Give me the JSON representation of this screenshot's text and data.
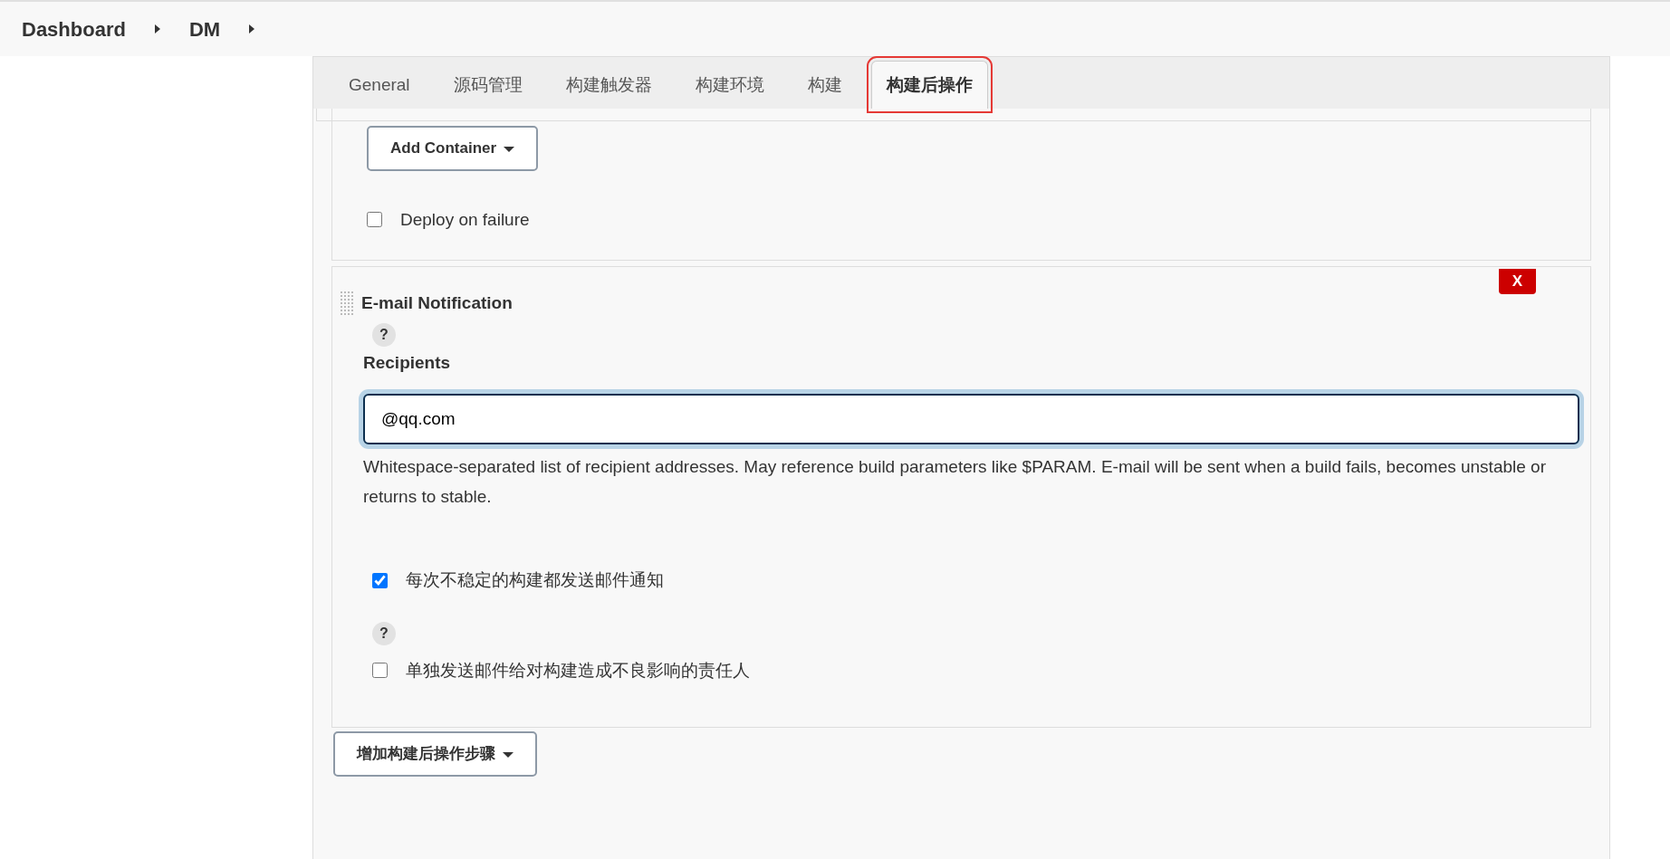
{
  "breadcrumb": [
    {
      "label": "Dashboard"
    },
    {
      "label": "DM"
    }
  ],
  "tabs": [
    {
      "label": "General",
      "selected": false
    },
    {
      "label": "源码管理",
      "selected": false
    },
    {
      "label": "构建触发器",
      "selected": false
    },
    {
      "label": "构建环境",
      "selected": false
    },
    {
      "label": "构建",
      "selected": false
    },
    {
      "label": "构建后操作",
      "selected": true
    }
  ],
  "previous_section": {
    "add_button": "Add Container",
    "deploy_on_failure": {
      "label": "Deploy on failure",
      "checked": false
    }
  },
  "email_section": {
    "title": "E-mail Notification",
    "delete_button": "X",
    "help": "?",
    "recipients_label": "Recipients",
    "recipients_value": "@qq.com",
    "description": "Whitespace-separated list of recipient addresses. May reference build parameters like $PARAM. E-mail will be sent when a build fails, becomes unstable or returns to stable.",
    "options": [
      {
        "label": "每次不稳定的构建都发送邮件通知",
        "checked": true
      },
      {
        "label": "单独发送邮件给对构建造成不良影响的责任人",
        "checked": false,
        "help": "?"
      }
    ]
  },
  "add_step_button": "增加构建后操作步骤"
}
